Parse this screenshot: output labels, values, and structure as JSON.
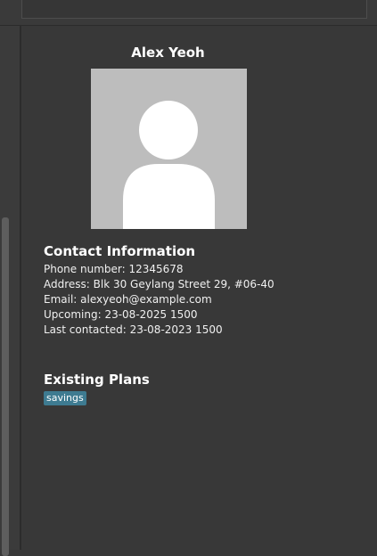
{
  "person": {
    "name": "Alex Yeoh"
  },
  "contact": {
    "title": "Contact Information",
    "phone": "Phone number: 12345678",
    "address": "Address: Blk 30 Geylang Street 29, #06-40",
    "email": "Email: alexyeoh@example.com",
    "upcoming": "Upcoming: 23-08-2025 1500",
    "last_contacted": "Last contacted: 23-08-2023 1500"
  },
  "plans": {
    "title": "Existing Plans",
    "tags": [
      "savings"
    ]
  },
  "colors": {
    "background": "#383838",
    "avatar_bg": "#bdbdbd",
    "tag_bg": "#3e7b91"
  }
}
